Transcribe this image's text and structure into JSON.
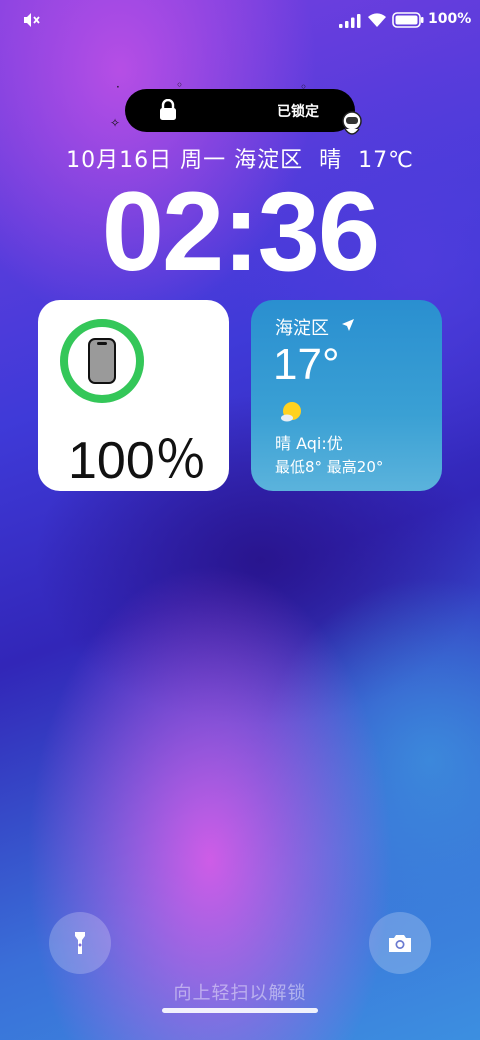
{
  "status_bar": {
    "battery_percent": "100%",
    "icons": [
      "mute-icon",
      "signal-icon",
      "wifi-icon",
      "battery-icon"
    ]
  },
  "lock_pill": {
    "label": "已锁定",
    "icon": "lock-icon"
  },
  "date_line": {
    "date": "10月16日",
    "weekday": "周一",
    "location": "海淀区",
    "weather": "晴",
    "temperature": "17℃"
  },
  "clock": {
    "time": "02:36"
  },
  "battery_widget": {
    "percent_label": "100％",
    "level": 1.0,
    "ring_color": "#34c759",
    "icon": "phone-icon"
  },
  "weather_widget": {
    "location": "海淀区",
    "temperature": "17°",
    "condition": "晴 Aqi:优",
    "range": "最低8°  最高20°",
    "icons": [
      "location-arrow-icon",
      "sun-icon"
    ]
  },
  "bottom": {
    "unlock_hint": "向上轻扫以解锁",
    "left_button_icon": "flashlight-icon",
    "right_button_icon": "camera-icon"
  }
}
